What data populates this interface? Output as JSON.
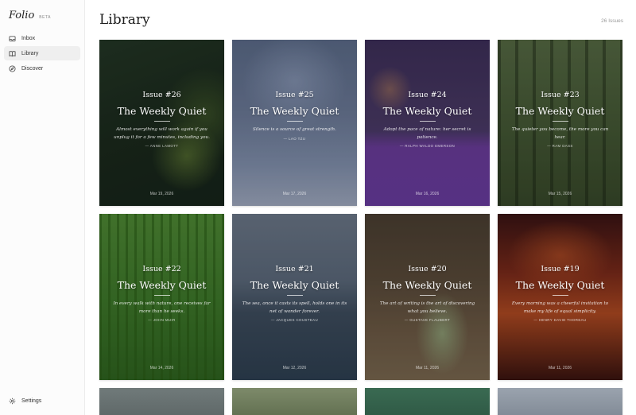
{
  "app": {
    "brand": "Folio",
    "badge": "BETA"
  },
  "nav": [
    {
      "label": "Inbox",
      "icon": "inbox-icon",
      "active": false
    },
    {
      "label": "Library",
      "icon": "book-icon",
      "active": true
    },
    {
      "label": "Discover",
      "icon": "compass-icon",
      "active": false
    }
  ],
  "settings": {
    "label": "Settings",
    "icon": "gear-icon"
  },
  "header": {
    "title": "Library",
    "count": "26 Issues"
  },
  "issues": [
    {
      "issue": "Issue #26",
      "title": "The Weekly Quiet",
      "quote": "Almost everything will work again if you unplug it for a few minutes, including you.",
      "author": "— ANNE LAMOTT",
      "date": "Mar 19, 2026",
      "bg": "bg-26"
    },
    {
      "issue": "Issue #25",
      "title": "The Weekly Quiet",
      "quote": "Silence is a source of great strength.",
      "author": "— LAO TZU",
      "date": "Mar 17, 2026",
      "bg": "bg-25"
    },
    {
      "issue": "Issue #24",
      "title": "The Weekly Quiet",
      "quote": "Adopt the pace of nature: her secret is patience.",
      "author": "— RALPH WALDO EMERSON",
      "date": "Mar 16, 2026",
      "bg": "bg-24"
    },
    {
      "issue": "Issue #23",
      "title": "The Weekly Quiet",
      "quote": "The quieter you become, the more you can hear.",
      "author": "— RAM DASS",
      "date": "Mar 15, 2026",
      "bg": "bg-23"
    },
    {
      "issue": "Issue #22",
      "title": "The Weekly Quiet",
      "quote": "In every walk with nature, one receives far more than he seeks.",
      "author": "— JOHN MUIR",
      "date": "Mar 14, 2026",
      "bg": "bg-22"
    },
    {
      "issue": "Issue #21",
      "title": "The Weekly Quiet",
      "quote": "The sea, once it casts its spell, holds one in its net of wonder forever.",
      "author": "— JACQUES COUSTEAU",
      "date": "Mar 12, 2026",
      "bg": "bg-21"
    },
    {
      "issue": "Issue #20",
      "title": "The Weekly Quiet",
      "quote": "The art of writing is the art of discovering what you believe.",
      "author": "— GUSTAVE FLAUBERT",
      "date": "Mar 11, 2026",
      "bg": "bg-20"
    },
    {
      "issue": "Issue #19",
      "title": "The Weekly Quiet",
      "quote": "Every morning was a cheerful invitation to make my life of equal simplicity.",
      "author": "— HENRY DAVID THOREAU",
      "date": "Mar 11, 2026",
      "bg": "bg-19"
    }
  ],
  "peek_cards": [
    "bg-18",
    "bg-17",
    "bg-16",
    "bg-15"
  ]
}
